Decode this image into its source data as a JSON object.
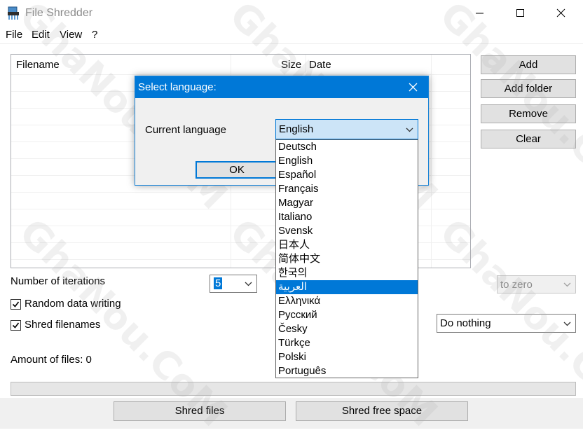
{
  "window": {
    "title": "File Shredder"
  },
  "menu": {
    "items": [
      "File",
      "Edit",
      "View",
      "?"
    ]
  },
  "file_list": {
    "columns": [
      "Filename",
      "Size",
      "Date"
    ]
  },
  "side_buttons": {
    "add": "Add",
    "add_folder": "Add folder",
    "remove": "Remove",
    "clear": "Clear"
  },
  "options": {
    "iterations_label": "Number of iterations",
    "iterations_value": "5",
    "random_data_label": "Random data writing",
    "random_data_checked": true,
    "shred_filenames_label": "Shred filenames",
    "shred_filenames_checked": true,
    "fill_mode_value": "to zero",
    "after_action_value": "Do nothing"
  },
  "status": {
    "amount_of_files": "Amount of files: 0",
    "progress": 0
  },
  "bottom_buttons": {
    "shred_files": "Shred files",
    "shred_free_space": "Shred free space"
  },
  "watermark": {
    "text": "GhaNou.CoM"
  },
  "language_dialog": {
    "title": "Select language:",
    "current_language_label": "Current language",
    "current_language_value": "English",
    "ok_label": "OK",
    "options": [
      "Deutsch",
      "English",
      "Español",
      "Français",
      "Magyar",
      "Italiano",
      "Svensk",
      "日本人",
      "简体中文",
      "한국의",
      "العربية",
      "Ελληνικά",
      "Русский",
      "Česky",
      "Türkçe",
      "Polski",
      "Português"
    ],
    "highlighted_option": "العربية"
  },
  "colors": {
    "accent": "#0078d7",
    "selection_highlight": "#0078d7",
    "combo_focus_fill": "#cce4f7",
    "button_face": "#e1e1e1"
  }
}
